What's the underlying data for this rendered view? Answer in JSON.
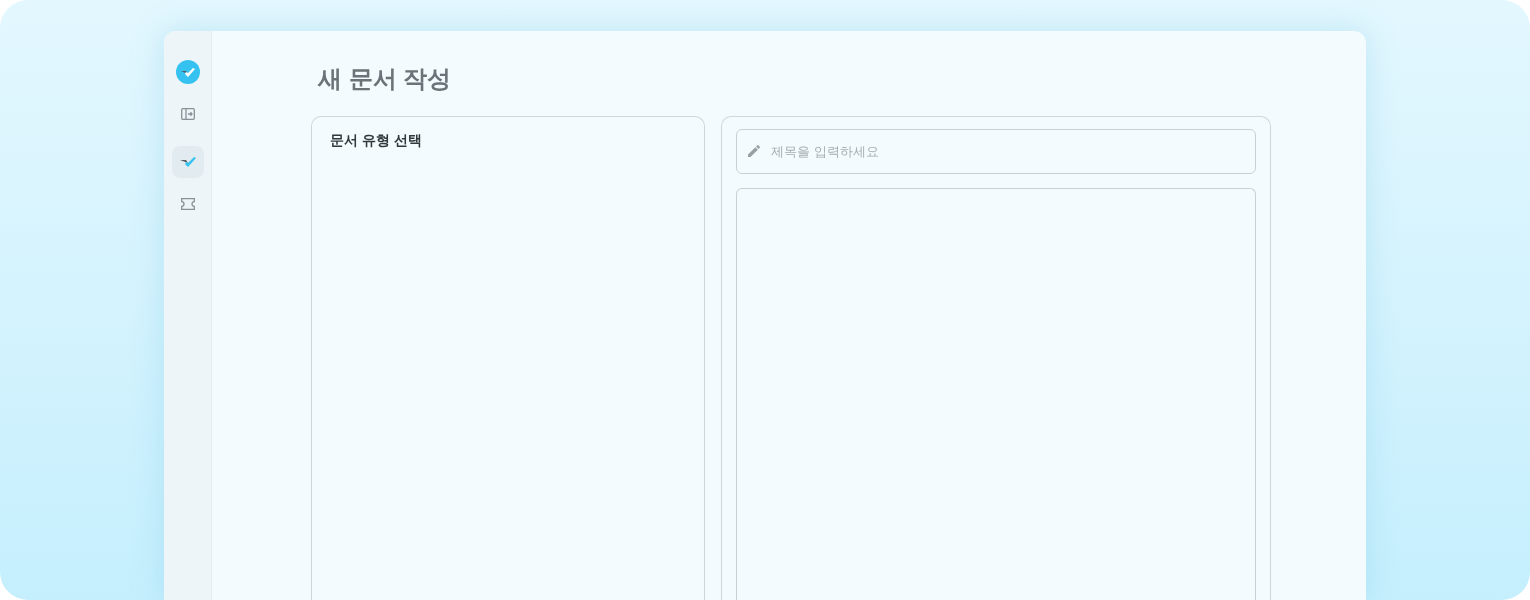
{
  "sidebar": {
    "items": [
      {
        "kind": "panel",
        "selected": false
      },
      {
        "kind": "check",
        "selected": true
      },
      {
        "kind": "ticket",
        "selected": false
      }
    ]
  },
  "page": {
    "title": "새 문서 작성"
  },
  "type_panel": {
    "title": "문서 유형 선택"
  },
  "editor": {
    "title_field": {
      "placeholder": "제목을 입력하세요"
    }
  }
}
